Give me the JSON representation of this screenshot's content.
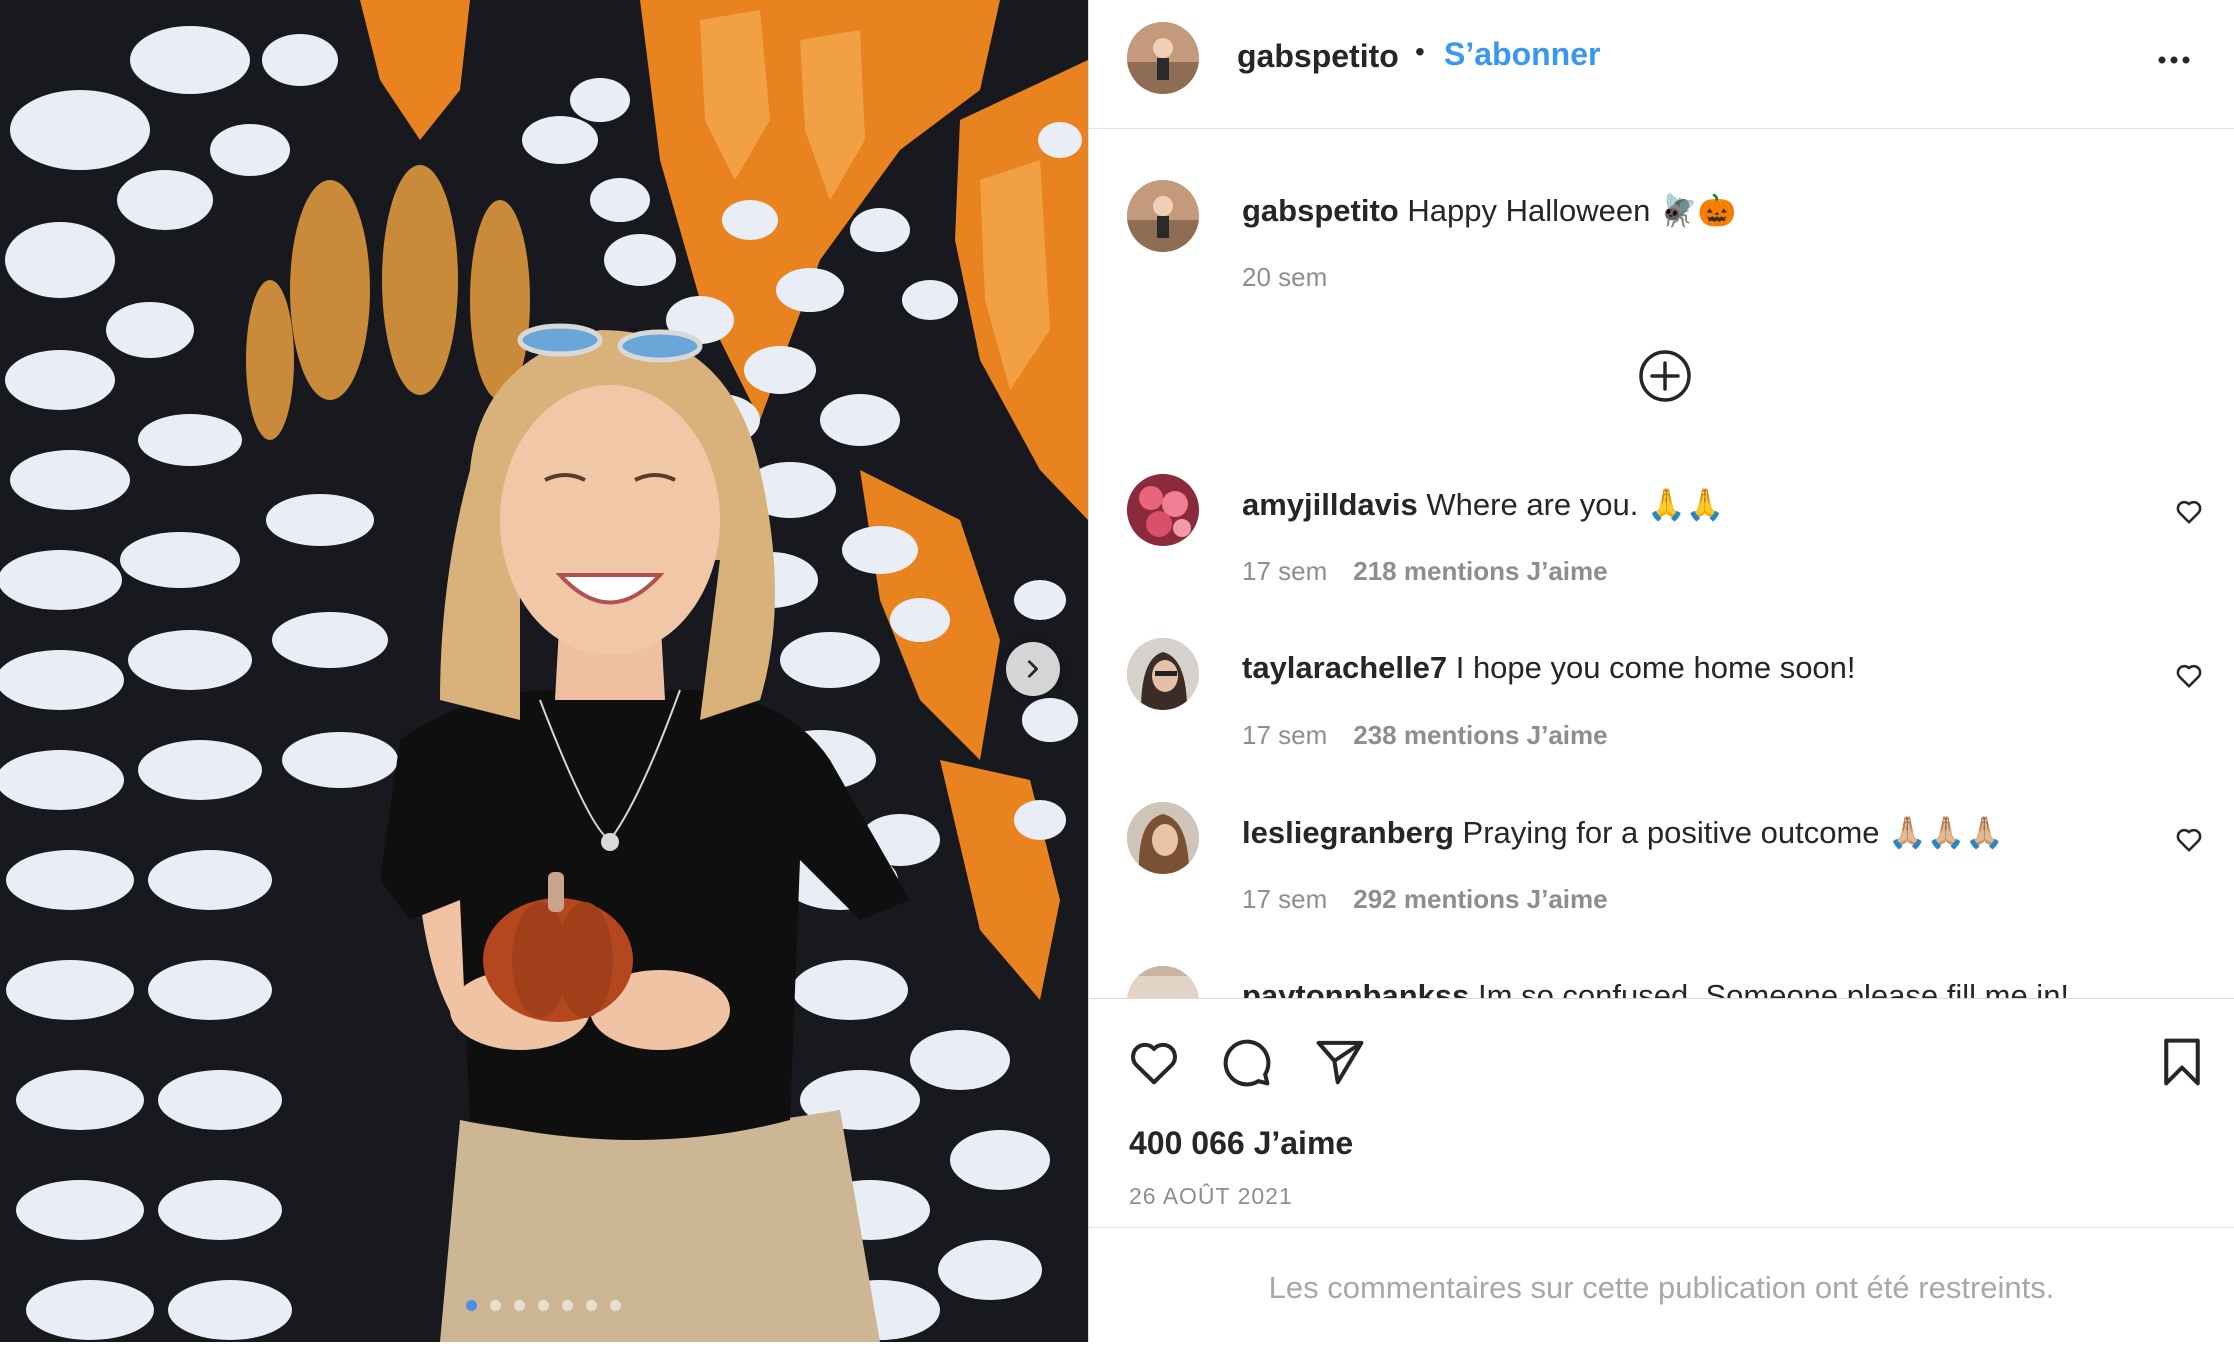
{
  "post": {
    "username": "gabspetito",
    "separator": "•",
    "follow_label": "S’abonner",
    "caption_username": "gabspetito",
    "caption_text": "Happy Halloween 🪰🎃",
    "caption_time": "20 sem",
    "likes_count": "400 066 J’aime",
    "date": "26 AOÛT 2021",
    "comments_restricted": "Les commentaires sur cette publication ont été restreints."
  },
  "carousel": {
    "slide_count": 7,
    "active_index": 0
  },
  "comments": [
    {
      "username": "amyjilldavis",
      "text": "Where are you. 🙏🙏",
      "time": "17 sem",
      "likes": "218 mentions J’aime",
      "avatar_color": "#d8506a"
    },
    {
      "username": "taylarachelle7",
      "text": "I hope you come home soon!",
      "time": "17 sem",
      "likes": "238 mentions J’aime",
      "avatar_color": "#5a4a44"
    },
    {
      "username": "lesliegranberg",
      "text": "Praying for a positive outcome 🙏🏼🙏🏼🙏🏼",
      "time": "17 sem",
      "likes": "292 mentions J’aime",
      "avatar_color": "#b08a6a"
    },
    {
      "username": "paytonnbankss",
      "text": "Im so confused. Someone please fill me in!",
      "time": "",
      "likes": "",
      "avatar_color": "#d9c7b8"
    }
  ],
  "icons": {
    "more": "more-horizontal-icon",
    "load_more": "plus-circle-icon",
    "like": "heart-icon",
    "comment": "comment-bubble-icon",
    "share": "paper-plane-icon",
    "save": "bookmark-icon",
    "next": "chevron-right-icon"
  },
  "colors": {
    "link_blue": "#3897f0",
    "text": "#262626",
    "muted": "#8e8e8e"
  }
}
